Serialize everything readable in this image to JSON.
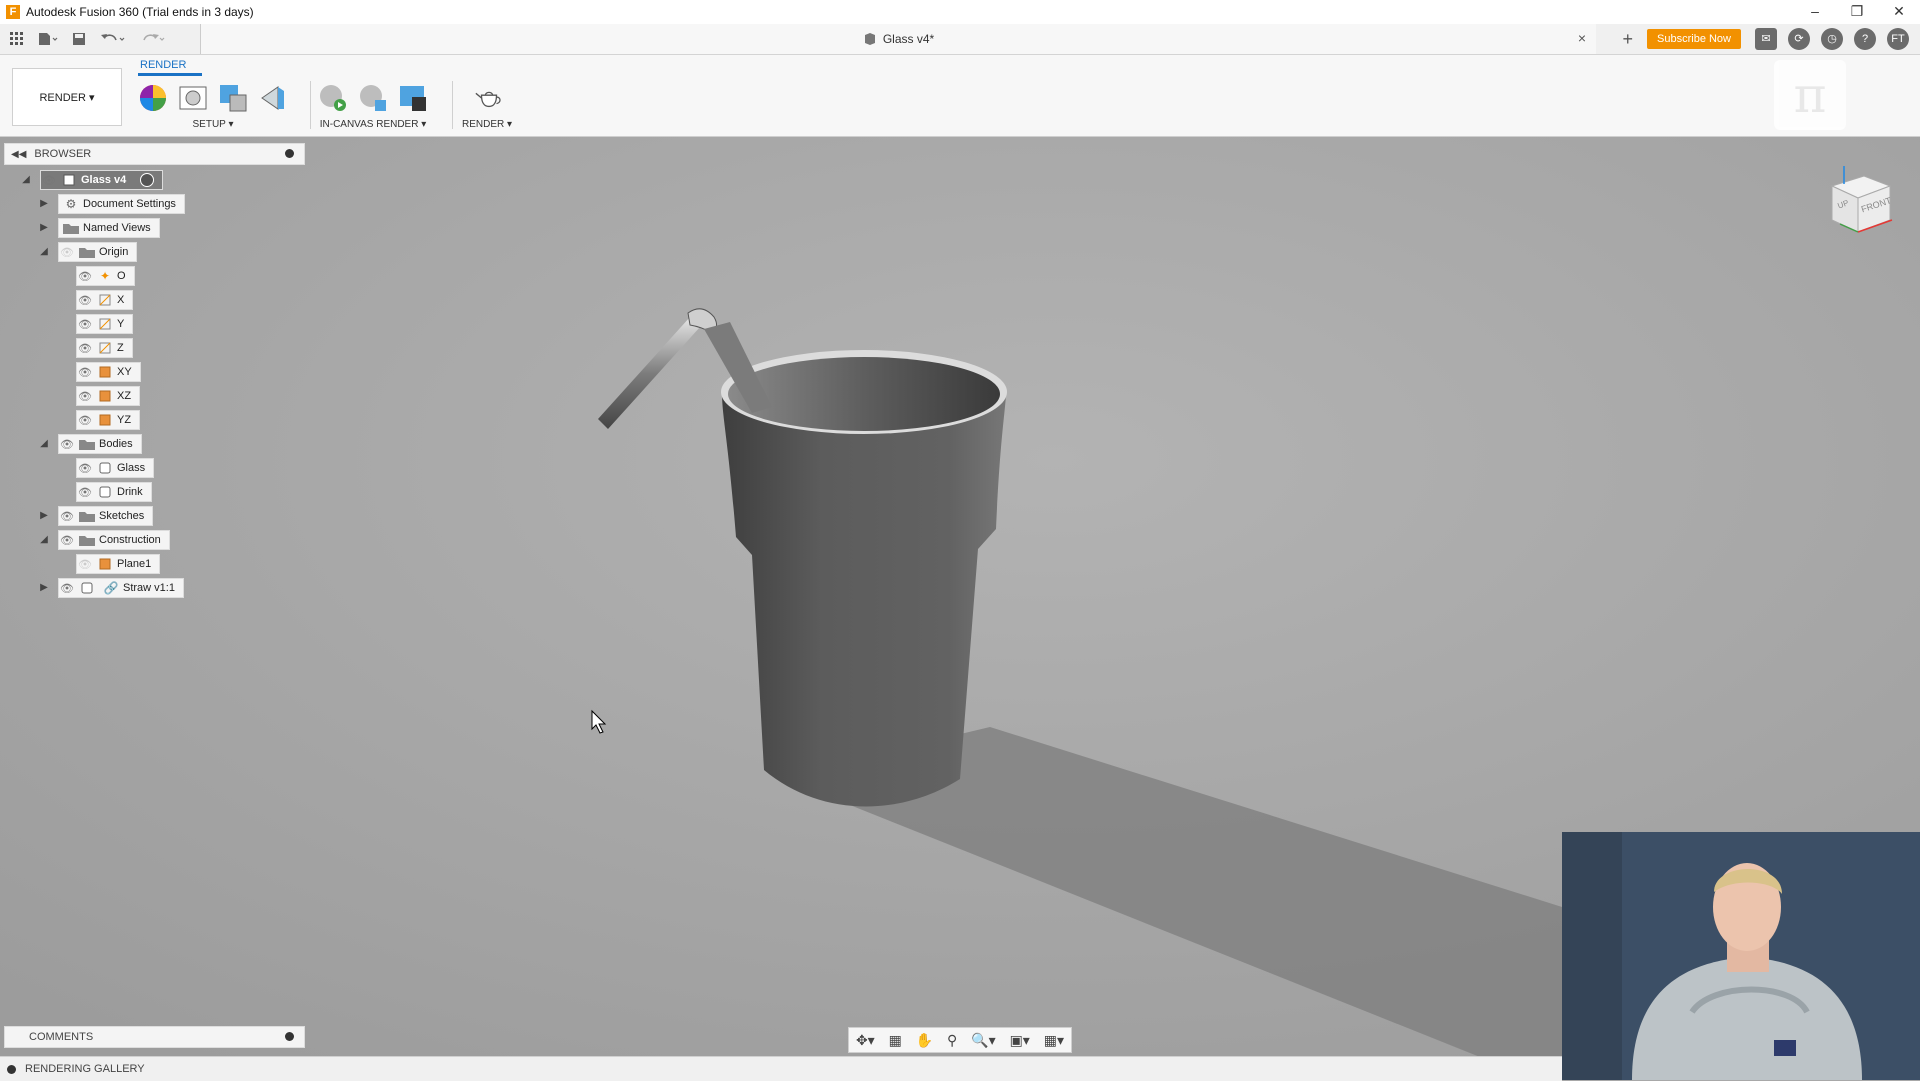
{
  "window": {
    "title": "Autodesk Fusion 360 (Trial ends in 3 days)",
    "app_icon": "F",
    "controls": [
      "minimize-icon",
      "restore-icon",
      "close-icon"
    ]
  },
  "qat": {
    "apps_icon": "grid-icon",
    "file_icon": "file-icon",
    "save_icon": "save-icon",
    "undo_icon": "undo-icon",
    "redo_icon": "redo-icon"
  },
  "document_tab": {
    "title": "Glass v4*",
    "close": "×"
  },
  "top_right": {
    "subscribe_label": "Subscribe Now",
    "user_initials": "FT",
    "add_tab": "+"
  },
  "ribbon": {
    "active_tab": "RENDER",
    "workspace_label": "RENDER ▾",
    "groups": [
      {
        "label": "SETUP ▾"
      },
      {
        "label": "IN-CANVAS RENDER ▾"
      },
      {
        "label": "RENDER ▾"
      }
    ]
  },
  "browser": {
    "header_label": "BROWSER",
    "root": "Glass v4",
    "items": [
      {
        "label": "Document Settings"
      },
      {
        "label": "Named Views"
      },
      {
        "label": "Origin"
      },
      {
        "label": "O"
      },
      {
        "label": "X"
      },
      {
        "label": "Y"
      },
      {
        "label": "Z"
      },
      {
        "label": "XY"
      },
      {
        "label": "XZ"
      },
      {
        "label": "YZ"
      },
      {
        "label": "Bodies"
      },
      {
        "label": "Glass"
      },
      {
        "label": "Drink"
      },
      {
        "label": "Sketches"
      },
      {
        "label": "Construction"
      },
      {
        "label": "Plane1"
      },
      {
        "label": "Straw v1:1"
      }
    ]
  },
  "viewcube": {
    "front_label": "FRONT",
    "up_label": "UP"
  },
  "comments": {
    "label": "COMMENTS"
  },
  "rendering_gallery": {
    "label": "RENDERING GALLERY"
  },
  "colors": {
    "accent": "#1a72c5",
    "subscribe": "#f29100",
    "canvas": "#a8a8a8"
  }
}
